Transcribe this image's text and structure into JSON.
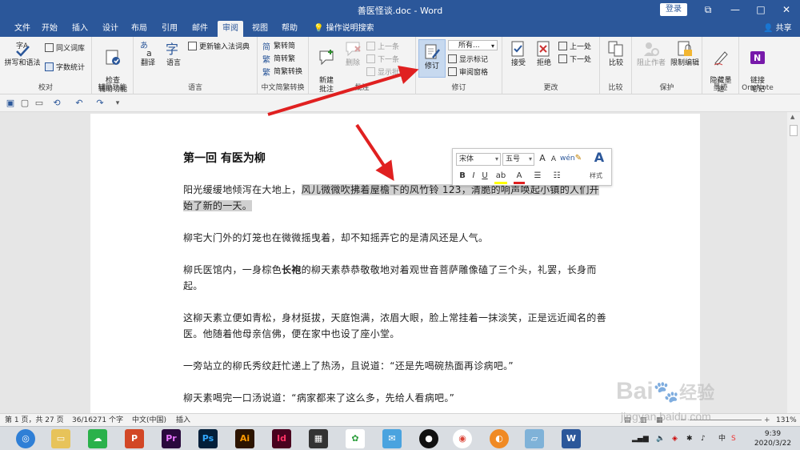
{
  "window": {
    "title": "善医怪谈.doc - Word",
    "login": "登录",
    "restore_glyph": "⧉",
    "minimize_glyph": "—",
    "maximize_glyph": "□",
    "close_glyph": "✕"
  },
  "tabs": [
    {
      "label": "文件"
    },
    {
      "label": "开始"
    },
    {
      "label": "插入"
    },
    {
      "label": "设计"
    },
    {
      "label": "布局"
    },
    {
      "label": "引用"
    },
    {
      "label": "邮件"
    },
    {
      "label": "审阅"
    },
    {
      "label": "视图"
    },
    {
      "label": "帮助"
    },
    {
      "label": "操作说明搜索"
    }
  ],
  "share": "共享",
  "ribbon": {
    "proofing": {
      "label": "校对",
      "spelling": "拼写和语法",
      "thesaurus": "同义词库",
      "wordcount": "字数统计"
    },
    "accessibility": {
      "label": "辅助功能",
      "check": "检查\n辅助功能"
    },
    "language": {
      "label": "语言",
      "translate": "翻译",
      "language": "语言",
      "update_ime": "更新输入法词典"
    },
    "chinese_conv": {
      "label": "中文简繁转换",
      "to_traditional": "繁转简",
      "to_simplified": "简转繁",
      "convert": "简繁转换"
    },
    "comments": {
      "label": "批注",
      "new": "新建\n批注",
      "delete": "删除",
      "prev": "上一条",
      "next": "下一条",
      "show": "显示批注"
    },
    "tracking": {
      "label": "修订",
      "track": "修订",
      "markup": "所有...",
      "show_markup": "显示标记",
      "review_pane": "审阅窗格"
    },
    "changes": {
      "label": "更改",
      "accept": "接受",
      "reject": "拒绝",
      "prev": "上一处",
      "next": "下一处"
    },
    "compare": {
      "label": "比较",
      "compare": "比较"
    },
    "protect": {
      "label": "保护",
      "block_authors": "阻止作者",
      "restrict": "限制编辑"
    },
    "ink": {
      "label": "墨迹",
      "hide_ink": "隐藏墨\n迹"
    },
    "onenote": {
      "label": "OneNote",
      "linked_notes": "链接\n笔记"
    }
  },
  "document": {
    "heading": "第一回  有医为柳",
    "para1_pre": "阳光缓缓地倾泻在大地上，",
    "para1_sel": "风儿微微吹拂着屋檐下的风竹铃 123，清脆的响声唤起小镇的人们开始了新的一天。",
    "para2": "柳宅大门外的灯笼也在微微摇曳着，却不知摇弄它的是清风还是人气。",
    "para3_pre": "柳氏医馆内，一身棕色",
    "para3_bold": "长袍",
    "para3_post": "的柳天素恭恭敬敬地对着观世音菩萨雕像磕了三个头，礼罢，长身而起。",
    "para4": "这柳天素立便如青松，身材挺拔，天庭饱满，浓眉大眼，脸上常挂着一抹淡笑，正是远近闻名的善医。他随着他母亲信佛，便在家中也设了座小堂。",
    "para5": "一旁站立的柳氏秀纹赶忙递上了热汤，且说道：“还是先喝碗热面再诊病吧。”",
    "para6": "柳天素喝完一口汤说道：“病家都来了这么多，先给人看病吧。”"
  },
  "mini_toolbar": {
    "font": "宋体",
    "size": "五号",
    "grow": "A",
    "shrink": "A",
    "bold": "B",
    "italic": "I",
    "underline": "U",
    "style_label": "样式"
  },
  "status": {
    "page": "第 1 页，共 27 页",
    "words": "36/16271 个字",
    "lang": "中文(中国)",
    "mode": "插入",
    "zoom": "131%"
  },
  "taskbar": {
    "time": "9:39",
    "date": "2020/3/22",
    "ime": "中"
  },
  "watermark": {
    "brand": "Bai",
    "brand_tail": "经验",
    "url": "jingyan.baidu.com"
  },
  "colors": {
    "word_blue": "#2b579a",
    "arrow_red": "#e02020",
    "selection": "#d0d0d0"
  }
}
